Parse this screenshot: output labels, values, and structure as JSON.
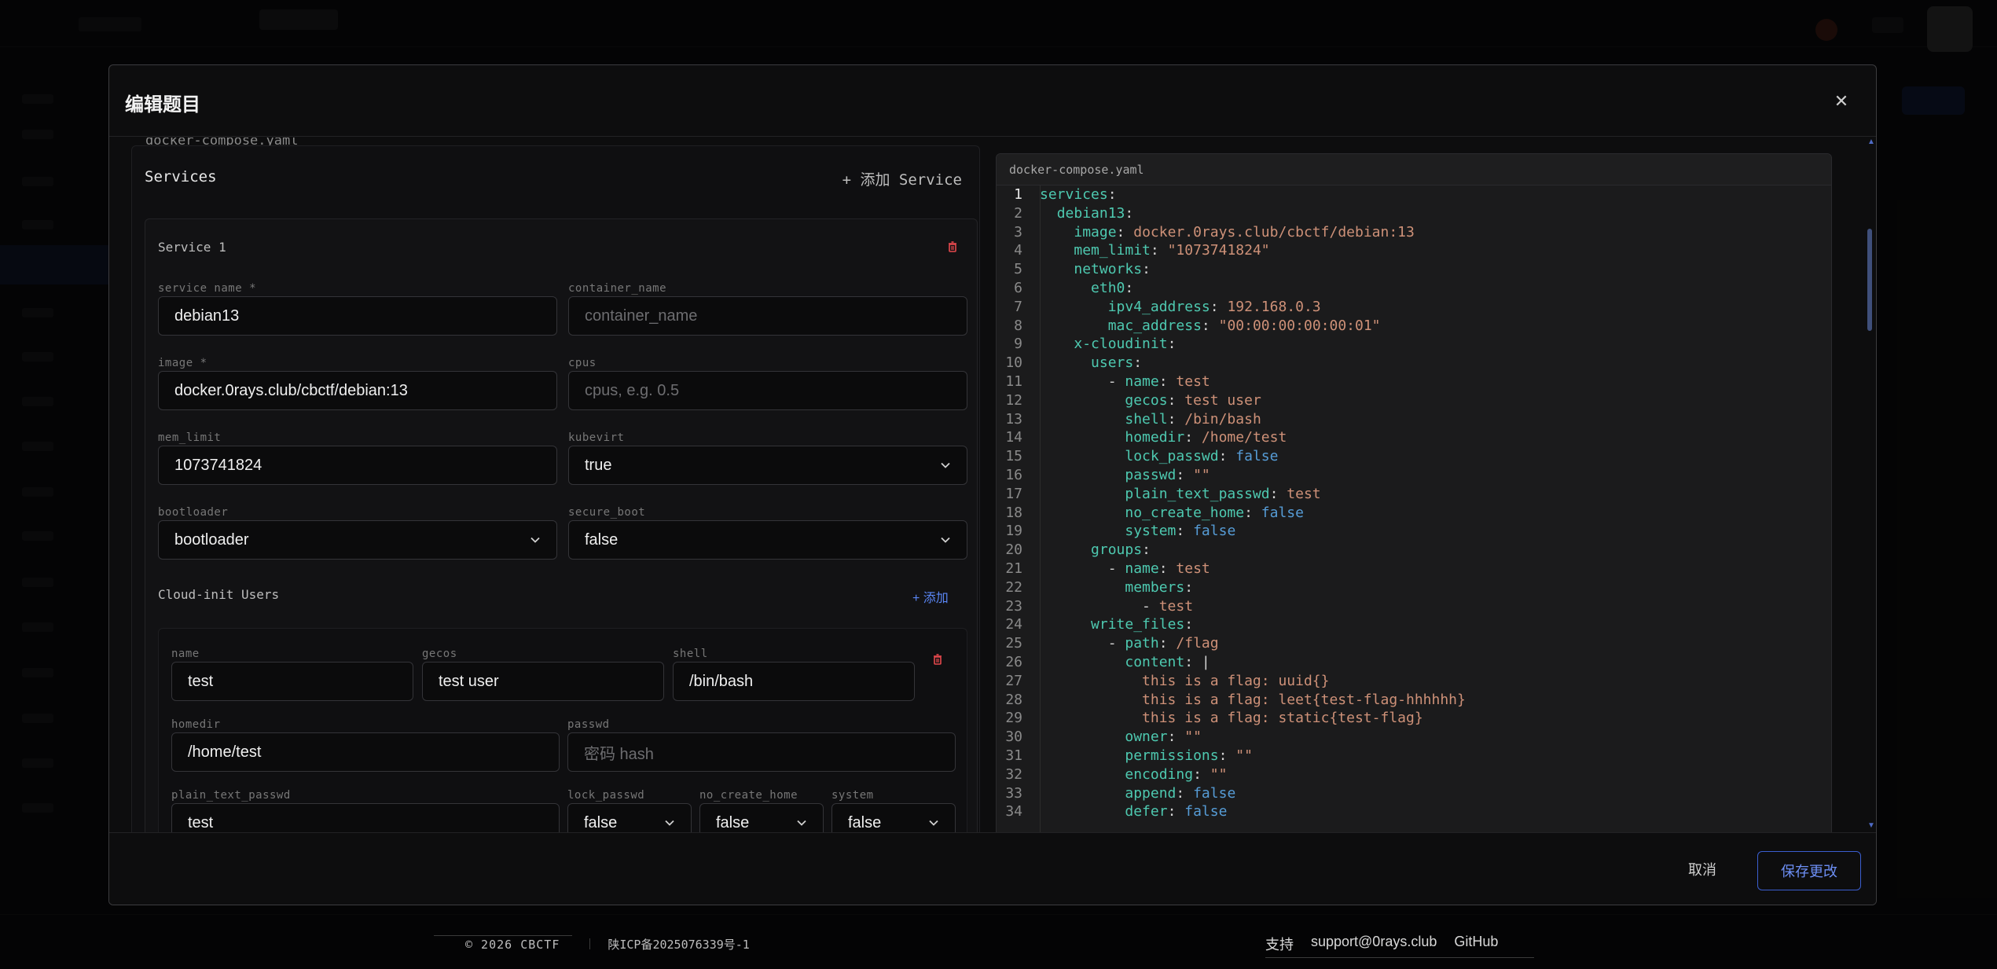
{
  "modal": {
    "title": "编辑题目",
    "close_glyph": "✕",
    "cancel_label": "取消",
    "save_label": "保存更改"
  },
  "form": {
    "cut_label": "docker-compose.yaml",
    "services_title": "Services",
    "add_service_label": "+ 添加 Service",
    "service": {
      "header": "Service 1",
      "fields": {
        "service_name": {
          "label": "service name *",
          "value": "debian13"
        },
        "container_name": {
          "label": "container_name",
          "placeholder": "container_name"
        },
        "image": {
          "label": "image *",
          "value": "docker.0rays.club/cbctf/debian:13"
        },
        "cpus": {
          "label": "cpus",
          "placeholder": "cpus, e.g. 0.5"
        },
        "mem_limit": {
          "label": "mem_limit",
          "value": "1073741824"
        },
        "kubevirt": {
          "label": "kubevirt",
          "value": "true"
        },
        "bootloader": {
          "label": "bootloader",
          "value": "bootloader"
        },
        "secure_boot": {
          "label": "secure_boot",
          "value": "false"
        }
      },
      "cloud_init": {
        "title": "Cloud-init Users",
        "add_label": "+ 添加",
        "user": {
          "name": {
            "label": "name",
            "value": "test"
          },
          "gecos": {
            "label": "gecos",
            "value": "test user"
          },
          "shell": {
            "label": "shell",
            "value": "/bin/bash"
          },
          "homedir": {
            "label": "homedir",
            "value": "/home/test"
          },
          "passwd": {
            "label": "passwd",
            "placeholder": "密码 hash"
          },
          "plain_text_passwd": {
            "label": "plain_text_passwd",
            "value": "test"
          },
          "lock_passwd": {
            "label": "lock_passwd",
            "value": "false"
          },
          "no_create_home": {
            "label": "no_create_home",
            "value": "false"
          },
          "system": {
            "label": "system",
            "value": "false"
          }
        }
      }
    }
  },
  "editor": {
    "tab": "docker-compose.yaml",
    "lines": [
      [
        [
          "k",
          "services"
        ],
        [
          "p",
          ":"
        ]
      ],
      [
        [
          "p",
          "  "
        ],
        [
          "k",
          "debian13"
        ],
        [
          "p",
          ":"
        ]
      ],
      [
        [
          "p",
          "    "
        ],
        [
          "k",
          "image"
        ],
        [
          "p",
          ": "
        ],
        [
          "s",
          "docker.0rays.club/cbctf/debian:13"
        ]
      ],
      [
        [
          "p",
          "    "
        ],
        [
          "k",
          "mem_limit"
        ],
        [
          "p",
          ": "
        ],
        [
          "s",
          "\"1073741824\""
        ]
      ],
      [
        [
          "p",
          "    "
        ],
        [
          "k",
          "networks"
        ],
        [
          "p",
          ":"
        ]
      ],
      [
        [
          "p",
          "      "
        ],
        [
          "k",
          "eth0"
        ],
        [
          "p",
          ":"
        ]
      ],
      [
        [
          "p",
          "        "
        ],
        [
          "k",
          "ipv4_address"
        ],
        [
          "p",
          ": "
        ],
        [
          "s",
          "192.168.0.3"
        ]
      ],
      [
        [
          "p",
          "        "
        ],
        [
          "k",
          "mac_address"
        ],
        [
          "p",
          ": "
        ],
        [
          "s",
          "\"00:00:00:00:00:01\""
        ]
      ],
      [
        [
          "p",
          "    "
        ],
        [
          "k",
          "x-cloudinit"
        ],
        [
          "p",
          ":"
        ]
      ],
      [
        [
          "p",
          "      "
        ],
        [
          "k",
          "users"
        ],
        [
          "p",
          ":"
        ]
      ],
      [
        [
          "p",
          "        - "
        ],
        [
          "k",
          "name"
        ],
        [
          "p",
          ": "
        ],
        [
          "s",
          "test"
        ]
      ],
      [
        [
          "p",
          "          "
        ],
        [
          "k",
          "gecos"
        ],
        [
          "p",
          ": "
        ],
        [
          "s",
          "test user"
        ]
      ],
      [
        [
          "p",
          "          "
        ],
        [
          "k",
          "shell"
        ],
        [
          "p",
          ": "
        ],
        [
          "s",
          "/bin/bash"
        ]
      ],
      [
        [
          "p",
          "          "
        ],
        [
          "k",
          "homedir"
        ],
        [
          "p",
          ": "
        ],
        [
          "s",
          "/home/test"
        ]
      ],
      [
        [
          "p",
          "          "
        ],
        [
          "k",
          "lock_passwd"
        ],
        [
          "p",
          ": "
        ],
        [
          "b",
          "false"
        ]
      ],
      [
        [
          "p",
          "          "
        ],
        [
          "k",
          "passwd"
        ],
        [
          "p",
          ": "
        ],
        [
          "s",
          "\"\""
        ]
      ],
      [
        [
          "p",
          "          "
        ],
        [
          "k",
          "plain_text_passwd"
        ],
        [
          "p",
          ": "
        ],
        [
          "s",
          "test"
        ]
      ],
      [
        [
          "p",
          "          "
        ],
        [
          "k",
          "no_create_home"
        ],
        [
          "p",
          ": "
        ],
        [
          "b",
          "false"
        ]
      ],
      [
        [
          "p",
          "          "
        ],
        [
          "k",
          "system"
        ],
        [
          "p",
          ": "
        ],
        [
          "b",
          "false"
        ]
      ],
      [
        [
          "p",
          "      "
        ],
        [
          "k",
          "groups"
        ],
        [
          "p",
          ":"
        ]
      ],
      [
        [
          "p",
          "        - "
        ],
        [
          "k",
          "name"
        ],
        [
          "p",
          ": "
        ],
        [
          "s",
          "test"
        ]
      ],
      [
        [
          "p",
          "          "
        ],
        [
          "k",
          "members"
        ],
        [
          "p",
          ":"
        ]
      ],
      [
        [
          "p",
          "            - "
        ],
        [
          "s",
          "test"
        ]
      ],
      [
        [
          "p",
          "      "
        ],
        [
          "k",
          "write_files"
        ],
        [
          "p",
          ":"
        ]
      ],
      [
        [
          "p",
          "        - "
        ],
        [
          "k",
          "path"
        ],
        [
          "p",
          ": "
        ],
        [
          "s",
          "/flag"
        ]
      ],
      [
        [
          "p",
          "          "
        ],
        [
          "k",
          "content"
        ],
        [
          "p",
          ": |"
        ]
      ],
      [
        [
          "p",
          "            "
        ],
        [
          "s",
          "this is a flag: uuid{}"
        ]
      ],
      [
        [
          "p",
          "            "
        ],
        [
          "s",
          "this is a flag: leet{test-flag-hhhhhh}"
        ]
      ],
      [
        [
          "p",
          "            "
        ],
        [
          "s",
          "this is a flag: static{test-flag}"
        ]
      ],
      [
        [
          "p",
          "          "
        ],
        [
          "k",
          "owner"
        ],
        [
          "p",
          ": "
        ],
        [
          "s",
          "\"\""
        ]
      ],
      [
        [
          "p",
          "          "
        ],
        [
          "k",
          "permissions"
        ],
        [
          "p",
          ": "
        ],
        [
          "s",
          "\"\""
        ]
      ],
      [
        [
          "p",
          "          "
        ],
        [
          "k",
          "encoding"
        ],
        [
          "p",
          ": "
        ],
        [
          "s",
          "\"\""
        ]
      ],
      [
        [
          "p",
          "          "
        ],
        [
          "k",
          "append"
        ],
        [
          "p",
          ": "
        ],
        [
          "b",
          "false"
        ]
      ],
      [
        [
          "p",
          "          "
        ],
        [
          "k",
          "defer"
        ],
        [
          "p",
          ": "
        ],
        [
          "b",
          "false"
        ]
      ]
    ]
  },
  "footer": {
    "copyright": "© 2026 CBCTF",
    "icp": "陕ICP备2025076339号-1",
    "links": [
      "支持",
      "support@0rays.club",
      "GitHub"
    ]
  },
  "colors": {
    "accent": "#5a86f5",
    "danger": "#e5484d",
    "yaml_key": "#4ec9b0",
    "yaml_string": "#ce9178",
    "yaml_bool": "#569cd6"
  }
}
